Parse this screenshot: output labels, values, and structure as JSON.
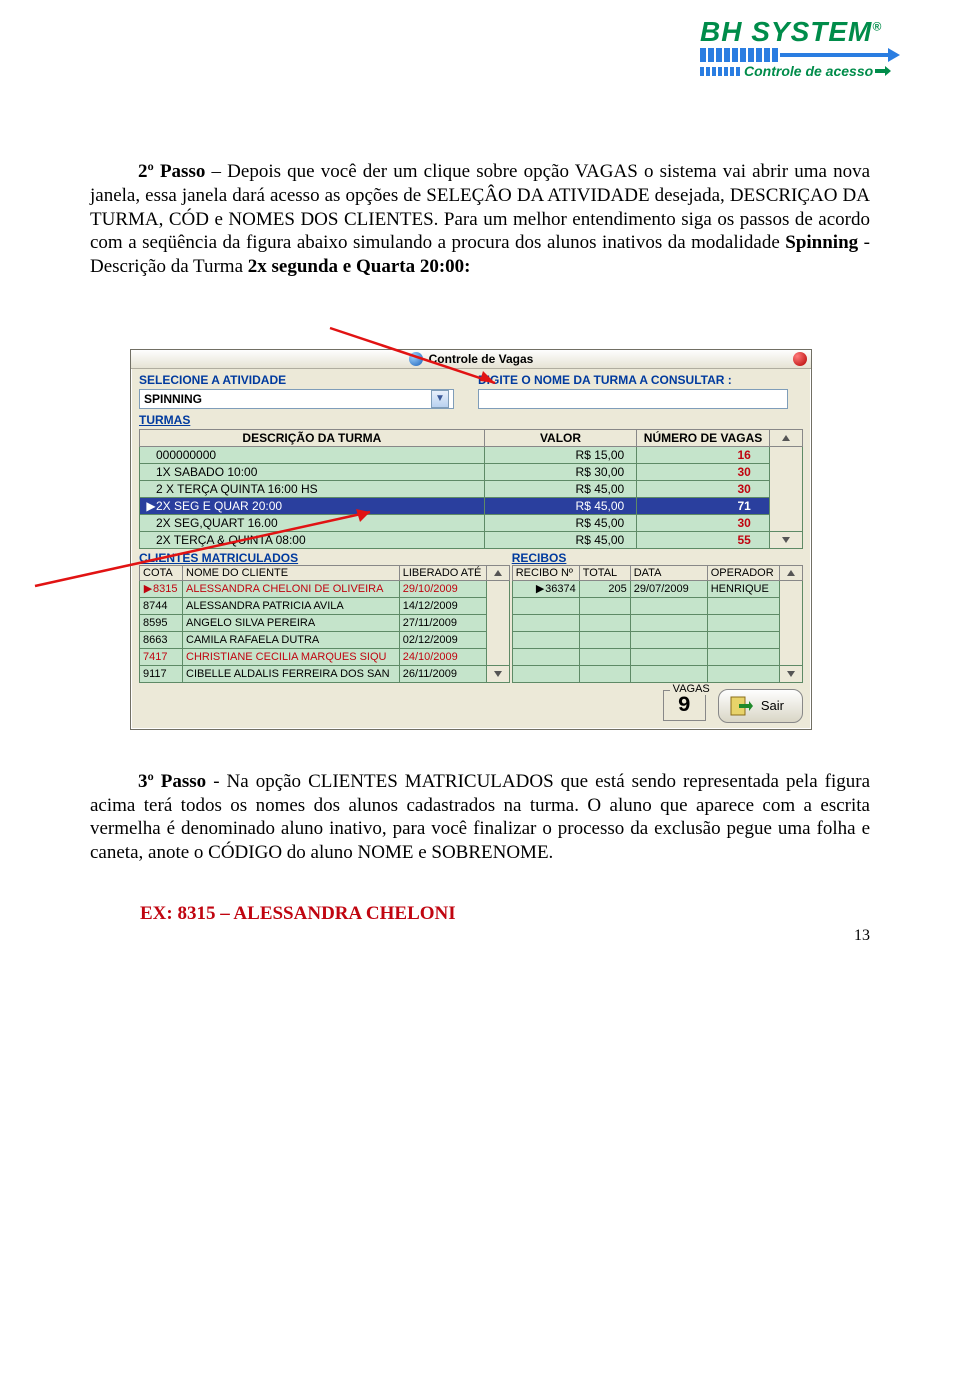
{
  "logo": {
    "main": "BH SYSTEM",
    "sub": "Controle de acesso"
  },
  "para1_a": "2º Passo",
  "para1_b": " – Depois que você der um clique sobre opção VAGAS o sistema vai abrir uma nova janela, essa janela dará acesso as opções de SELEÇÂO DA ATIVIDADE desejada, DESCRIÇAO DA TURMA, CÓD e NOMES DOS CLIENTES. Para um melhor entendimento siga os passos de acordo com a seqüência da figura abaixo simulando a procura dos alunos inativos da modalidade ",
  "para1_c": "Spinning",
  "para1_d": " - Descrição da Turma ",
  "para1_e": "2x segunda e Quarta 20:00:",
  "app": {
    "title": "Controle de Vagas",
    "left_label": "SELECIONE A ATIVIDADE",
    "left_value": "SPINNING",
    "right_label": "DIGITE O NOME DA TURMA A CONSULTAR :",
    "turmas_label": "TURMAS",
    "th_desc": "DESCRIÇÃO DA TURMA",
    "th_valor": "VALOR",
    "th_vagas": "NÚMERO DE VAGAS",
    "turmas": [
      {
        "desc": "000000000",
        "valor": "R$ 15,00",
        "vagas": "16"
      },
      {
        "desc": "1X SABADO 10:00",
        "valor": "R$ 30,00",
        "vagas": "30"
      },
      {
        "desc": "2 X TERÇA QUINTA 16:00 HS",
        "valor": "R$ 45,00",
        "vagas": "30"
      },
      {
        "desc": "2X SEG E QUAR 20:00",
        "valor": "R$ 45,00",
        "vagas": "71"
      },
      {
        "desc": "2X SEG,QUART 16.00",
        "valor": "R$ 45,00",
        "vagas": "30"
      },
      {
        "desc": "2X TERÇA & QUINTA 08:00",
        "valor": "R$ 45,00",
        "vagas": "55"
      }
    ],
    "clientes_label": "CLIENTES MATRICULADOS",
    "cli_th_cota": "COTA",
    "cli_th_nome": "NOME DO CLIENTE",
    "cli_th_lib": "LIBERADO ATÉ",
    "clientes": [
      {
        "cota": "8315",
        "nome": "ALESSANDRA CHELONI DE OLIVEIRA",
        "lib": "29/10/2009",
        "red": true
      },
      {
        "cota": "8744",
        "nome": "ALESSANDRA PATRICIA AVILA",
        "lib": "14/12/2009",
        "red": false
      },
      {
        "cota": "8595",
        "nome": "ANGELO SILVA PEREIRA",
        "lib": "27/11/2009",
        "red": false
      },
      {
        "cota": "8663",
        "nome": "CAMILA RAFAELA DUTRA",
        "lib": "02/12/2009",
        "red": false
      },
      {
        "cota": "7417",
        "nome": "CHRISTIANE CECILIA MARQUES SIQU",
        "lib": "24/10/2009",
        "red": true
      },
      {
        "cota": "9117",
        "nome": "CIBELLE ALDALIS FERREIRA DOS SAN",
        "lib": "26/11/2009",
        "red": false
      }
    ],
    "recibos_label": "RECIBOS",
    "rec_th_num": "RECIBO Nº",
    "rec_th_total": "TOTAL",
    "rec_th_data": "DATA",
    "rec_th_op": "OPERADOR",
    "recibos": [
      {
        "num": "36374",
        "total": "205",
        "data": "29/07/2009",
        "op": "HENRIQUE"
      }
    ],
    "vagas_label": "VAGAS",
    "vagas_value": "9",
    "sair": "Sair"
  },
  "para2_a": "3º Passo",
  "para2_b": " - Na opção CLIENTES MATRICULADOS que está sendo representada pela figura acima terá todos os nomes dos alunos cadastrados na turma. O aluno que aparece com a escrita vermelha é denominado aluno inativo, para você finalizar o processo da exclusão pegue uma folha e caneta, anote o CÓDIGO do aluno NOME e SOBRENOME.",
  "ex_line": "EX: 8315 – ALESSANDRA CHELONI",
  "pagenum": "13"
}
